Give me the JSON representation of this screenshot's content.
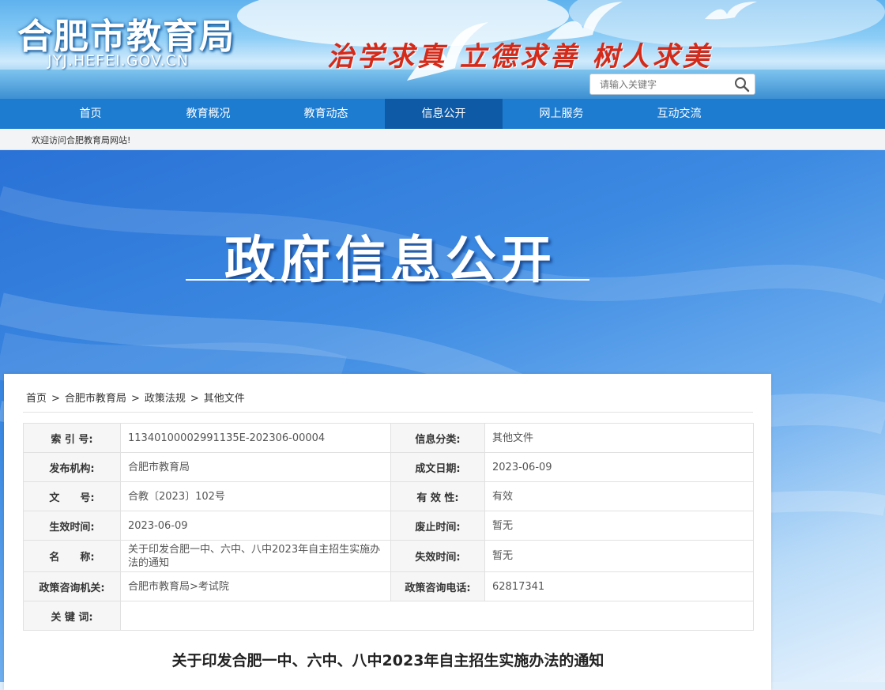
{
  "site": {
    "name": "合肥市教育局",
    "url": "JYJ.HEFEI.GOV.CN",
    "slogan": "治学求真  立德求善  树人求美"
  },
  "search": {
    "placeholder": "请输入关键字"
  },
  "nav": {
    "items": [
      "首页",
      "教育概况",
      "教育动态",
      "信息公开",
      "网上服务",
      "互动交流"
    ],
    "active": "信息公开"
  },
  "welcome": "欢迎访问合肥教育局网站!",
  "banner": {
    "title": "政府信息公开"
  },
  "breadcrumb": {
    "items": [
      "首页",
      "合肥市教育局",
      "政策法规",
      "其他文件"
    ],
    "separator": ">"
  },
  "info_table": {
    "rows": [
      [
        {
          "label": "索 引 号:",
          "value": "11340100002991135E-202306-00004"
        },
        {
          "label": "信息分类:",
          "value": "其他文件"
        }
      ],
      [
        {
          "label": "发布机构:",
          "value": "合肥市教育局"
        },
        {
          "label": "成文日期:",
          "value": "2023-06-09"
        }
      ],
      [
        {
          "label": "文　　号:",
          "value": "合教〔2023〕102号"
        },
        {
          "label": "有 效 性:",
          "value": "有效"
        }
      ],
      [
        {
          "label": "生效时间:",
          "value": "2023-06-09"
        },
        {
          "label": "废止时间:",
          "value": "暂无"
        }
      ],
      [
        {
          "label": "名　　称:",
          "value": "关于印发合肥一中、六中、八中2023年自主招生实施办法的通知"
        },
        {
          "label": "失效时间:",
          "value": "暂无"
        }
      ],
      [
        {
          "label": "政策咨询机关:",
          "value": "合肥市教育局>考试院"
        },
        {
          "label": "政策咨询电话:",
          "value": "62817341"
        }
      ]
    ],
    "keyword_label": "关 键 词:",
    "keyword_value": ""
  },
  "document": {
    "title": "关于印发合肥一中、六中、八中2023年自主招生实施办法的通知"
  },
  "colors": {
    "nav_bg": "#1d7cd0",
    "nav_active": "#0e5aa6",
    "slogan": "#d42a1a"
  }
}
